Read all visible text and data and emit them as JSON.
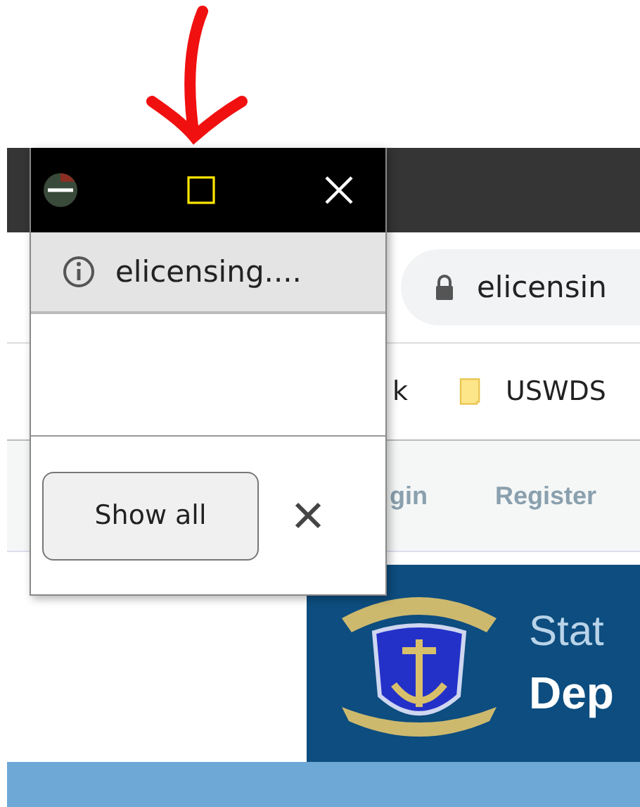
{
  "browser": {
    "address": "elicensin",
    "bookmarks": [
      {
        "label": "k",
        "kind": "text"
      },
      {
        "label": "USWDS",
        "kind": "folder"
      }
    ],
    "nav": [
      "gin",
      "Register"
    ]
  },
  "banner": {
    "line1": "Stat",
    "line2": "Dep"
  },
  "popup": {
    "url": "elicensing....",
    "button": "Show all"
  }
}
